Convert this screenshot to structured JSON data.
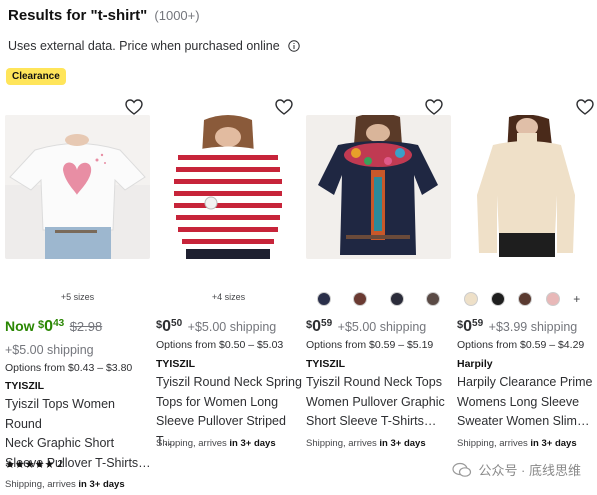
{
  "header": {
    "title": "Results for \"t-shirt\"",
    "count": "(1000+)"
  },
  "subheading": "Uses external data. Price when purchased online",
  "badge": "Clearance",
  "products": [
    {
      "sizes": "+5 sizes",
      "price_prefix": "Now",
      "price_dollar": "$",
      "price_main": "0",
      "price_cents": "43",
      "was_price": "$2.98",
      "shipping": "+$5.00 shipping",
      "options": "Options from $0.43 – $3.80",
      "brand": "TYISZIL",
      "title_lines": [
        "Tyiszil Tops Women Round",
        "Neck Graphic Short",
        "Sleeve Pullover T-Shirts…"
      ],
      "stars": "★★★★★",
      "reviews": "2",
      "delivery_prefix": "Shipping, arrives ",
      "delivery_bold": "in 3+ days"
    },
    {
      "sizes": "+4 sizes",
      "price_dollar": "$",
      "price_main": "0",
      "price_cents": "50",
      "shipping": "+$5.00 shipping",
      "options": "Options from $0.50 – $5.03",
      "brand": "TYISZIL",
      "title_lines": [
        "Tyiszil Round Neck Spring",
        "Tops for Women Long",
        "Sleeve Pullover Striped T…"
      ],
      "delivery_prefix": "Shipping, arrives ",
      "delivery_bold": "in 3+ days"
    },
    {
      "swatch_colors": [
        "#2a2f4a",
        "#6a3a32",
        "#2b2c3a",
        "#5a4a45"
      ],
      "price_dollar": "$",
      "price_main": "0",
      "price_cents": "59",
      "shipping": "+$5.00 shipping",
      "options": "Options from $0.59 – $5.19",
      "brand": "TYISZIL",
      "title_lines": [
        "Tyiszil Round Neck Tops",
        "Women Pullover Graphic",
        "Short Sleeve T-Shirts…"
      ],
      "delivery_prefix": "Shipping, arrives ",
      "delivery_bold": "in 3+ days"
    },
    {
      "swatch_colors": [
        "#eee0c8",
        "#1e1e1e",
        "#5a3a30",
        "#e8b8b8"
      ],
      "swatch_more": "+",
      "price_dollar": "$",
      "price_main": "0",
      "price_cents": "59",
      "shipping": "+$3.99 shipping",
      "options": "Options from $0.59 – $4.29",
      "brand": "Harpily",
      "title_lines": [
        "Harpily Clearance Prime",
        "Womens Long Sleeve",
        "Sweater Women Slim…"
      ],
      "delivery_prefix": "Shipping, arrives ",
      "delivery_bold": "in 3+ days"
    }
  ],
  "watermark": "公众号 · 底线思维",
  "colors": {
    "green": "#2a8703",
    "badge": "#ffe55a",
    "gray": "#74767c"
  }
}
